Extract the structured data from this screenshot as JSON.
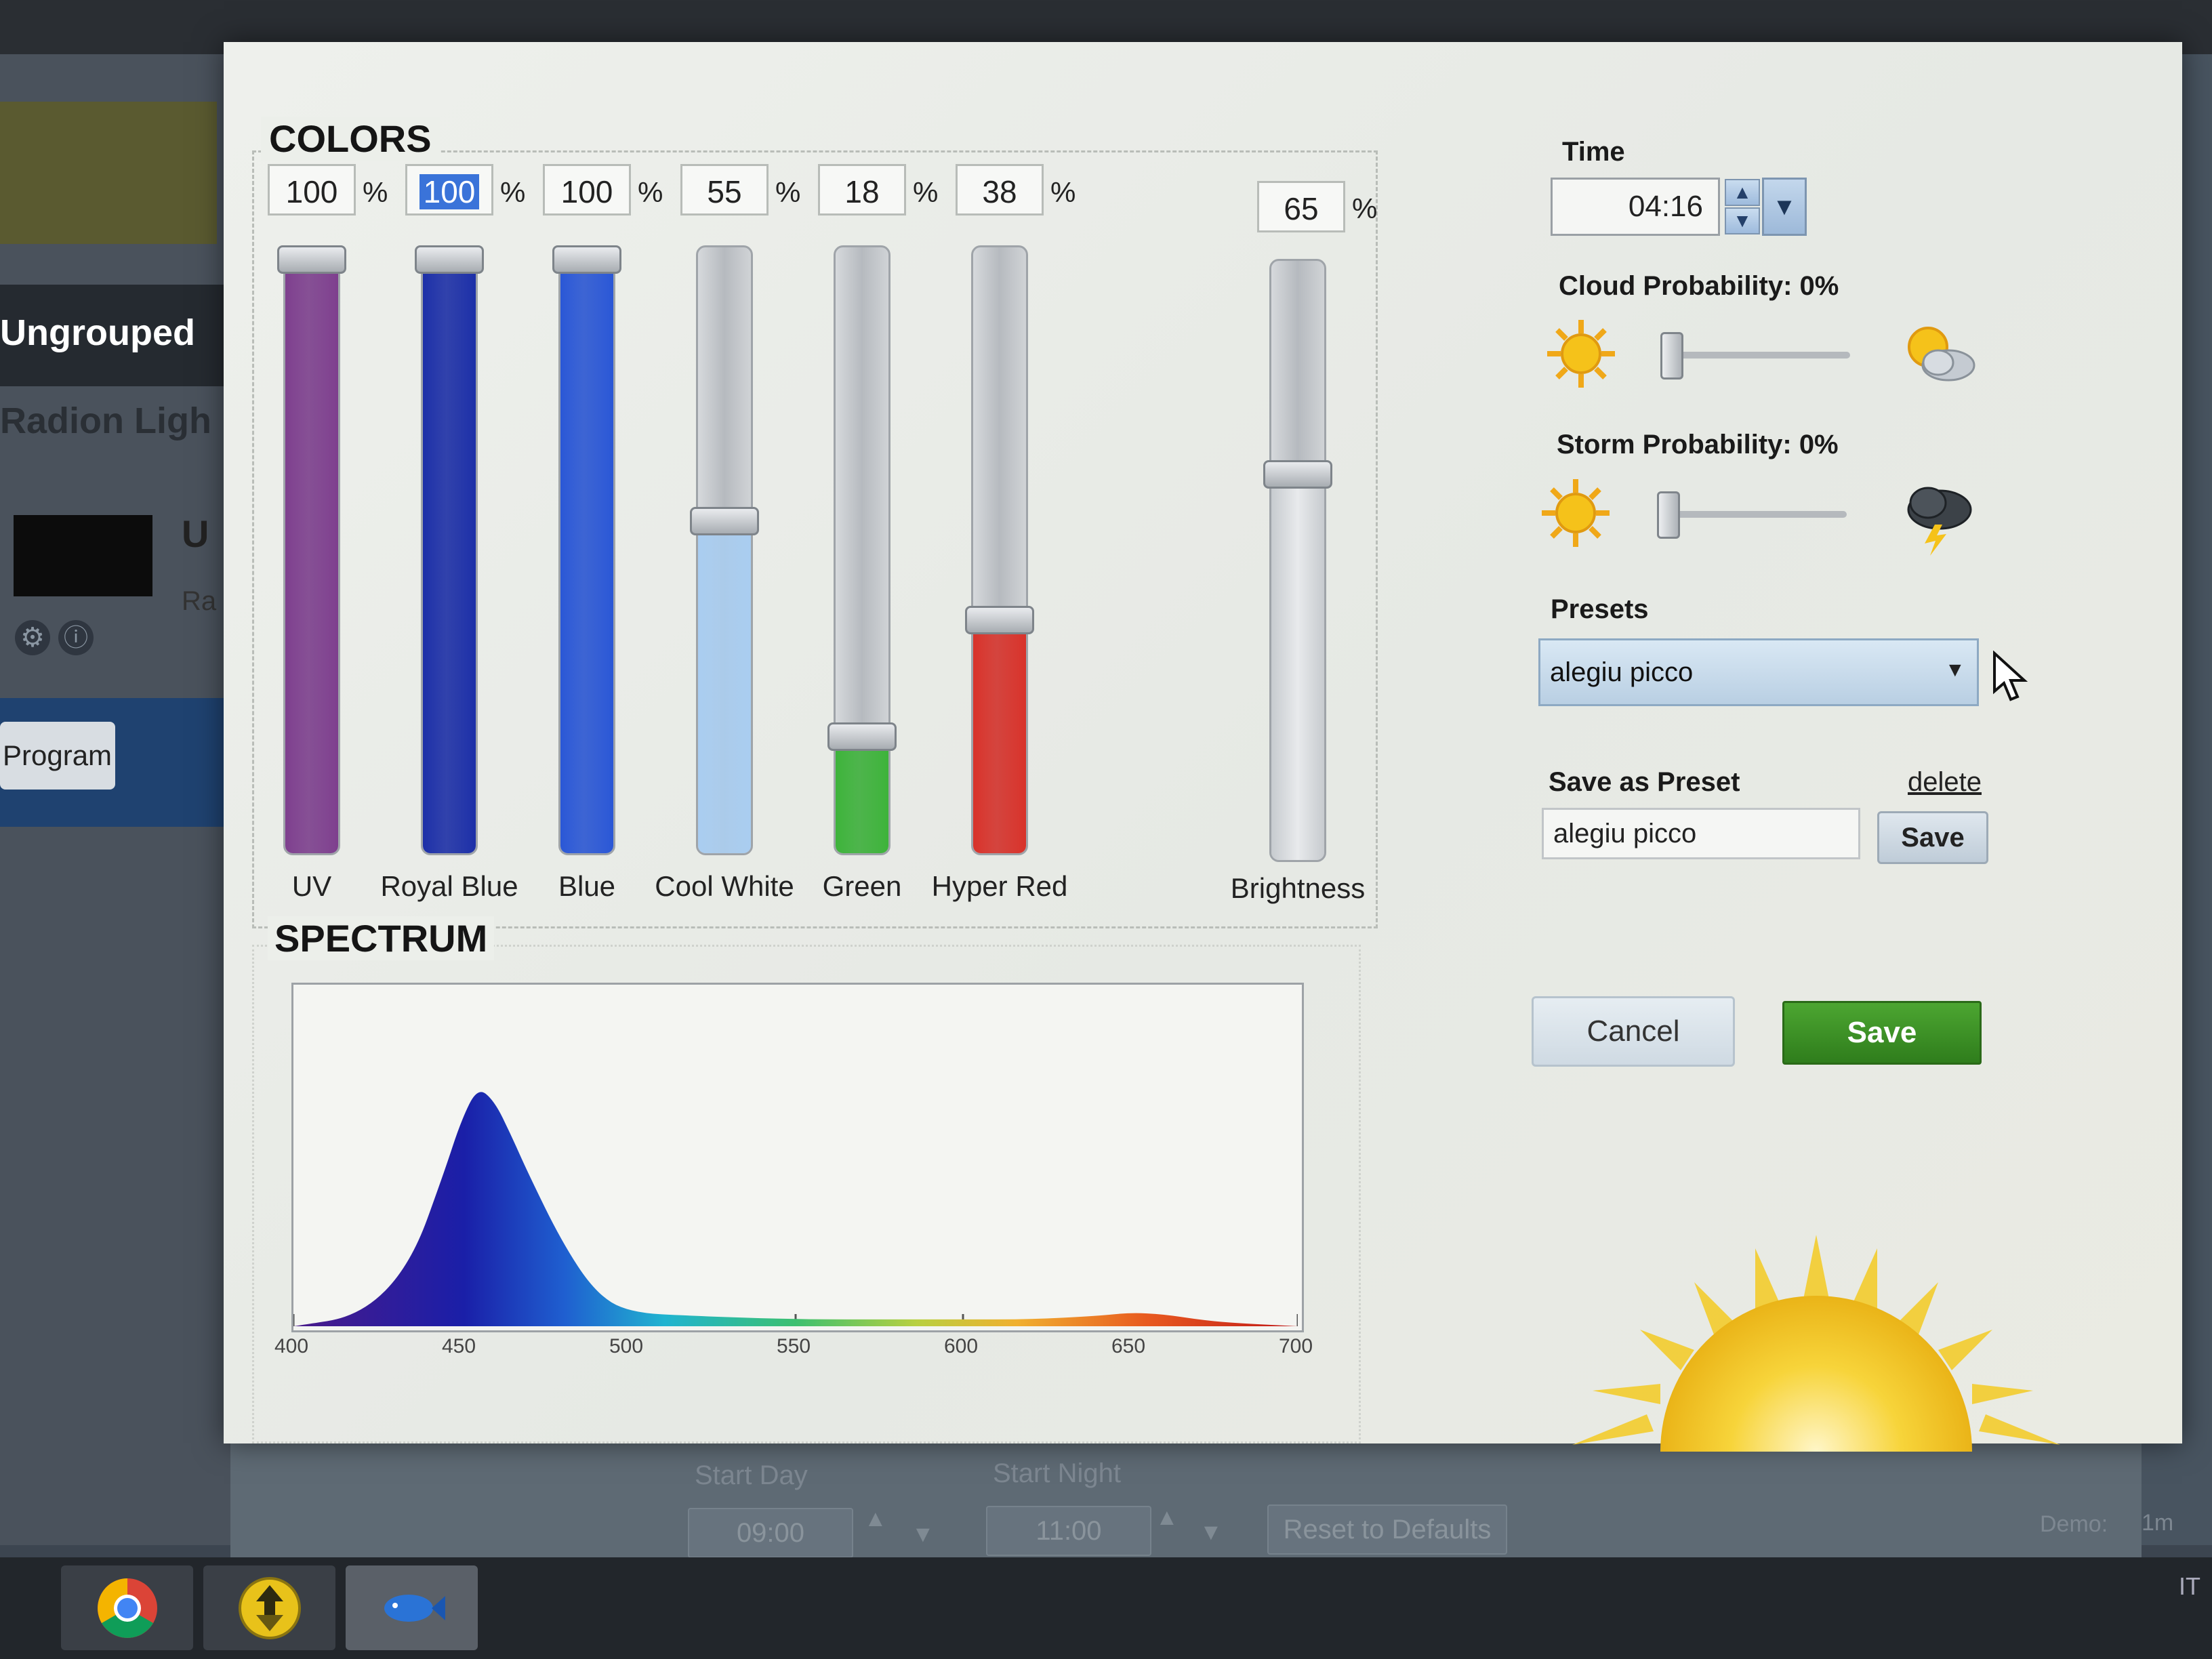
{
  "background_app": {
    "group_label": "Ungrouped",
    "device_label": "Radion Ligh",
    "device_name_partial": "U",
    "device_sub_partial": "Ra",
    "program_button": "Program",
    "start_day_label": "Start Day",
    "start_day_value": "09:00",
    "start_night_label": "Start Night",
    "start_night_value": "11:00",
    "reset_label": "Reset to Defaults",
    "demo_label": "Demo:",
    "demo_value": "1m"
  },
  "taskbar": {
    "items": [
      "chrome-icon",
      "updater-icon",
      "fish-app-icon"
    ],
    "tray_text": "IT"
  },
  "colors": {
    "title": "COLORS",
    "percent_sign": "%",
    "channels": [
      {
        "label": "UV",
        "value": "100",
        "level": 1.0,
        "color": "#7e3f8e"
      },
      {
        "label": "Royal Blue",
        "value": "100",
        "level": 1.0,
        "color": "#1c2fa8",
        "selected": true
      },
      {
        "label": "Blue",
        "value": "100",
        "level": 1.0,
        "color": "#2a57d6"
      },
      {
        "label": "Cool White",
        "value": "55",
        "level": 0.55,
        "color": "#a9cdf0"
      },
      {
        "label": "Green",
        "value": "18",
        "level": 0.18,
        "color": "#3db33a"
      },
      {
        "label": "Hyper Red",
        "value": "38",
        "level": 0.38,
        "color": "#d8322a"
      }
    ],
    "brightness": {
      "label": "Brightness",
      "value": "65",
      "level": 0.65
    }
  },
  "spectrum": {
    "title": "SPECTRUM"
  },
  "chart_data": {
    "type": "area",
    "title": "SPECTRUM",
    "xlabel": "",
    "ylabel": "",
    "x_ticks": [
      "400",
      "450",
      "500",
      "550",
      "600",
      "650",
      "700"
    ],
    "xlim": [
      400,
      700
    ],
    "ylim": [
      0,
      1
    ],
    "x": [
      400,
      420,
      435,
      445,
      450,
      455,
      460,
      465,
      470,
      480,
      490,
      500,
      520,
      550,
      580,
      600,
      620,
      640,
      650,
      660,
      670,
      680,
      700
    ],
    "series": [
      {
        "values": [
          0.0,
          0.03,
          0.18,
          0.45,
          0.6,
          0.7,
          0.66,
          0.56,
          0.45,
          0.25,
          0.1,
          0.04,
          0.03,
          0.02,
          0.02,
          0.02,
          0.02,
          0.03,
          0.04,
          0.035,
          0.02,
          0.01,
          0.0
        ]
      }
    ]
  },
  "right_panel": {
    "time_label": "Time",
    "time_value": "04:16",
    "cloud_label": "Cloud Probability: 0%",
    "cloud_level": 0,
    "storm_label": "Storm Probability: 0%",
    "storm_level": 0,
    "presets_label": "Presets",
    "preset_selected": "alegiu picco",
    "save_as_preset_label": "Save as Preset",
    "delete_label": "delete",
    "preset_name_value": "alegiu picco",
    "save_small_label": "Save",
    "cancel_label": "Cancel",
    "save_label": "Save"
  },
  "theme": {
    "accent_green": "#3a8f25",
    "sun_yellow": "#f2c21a"
  }
}
